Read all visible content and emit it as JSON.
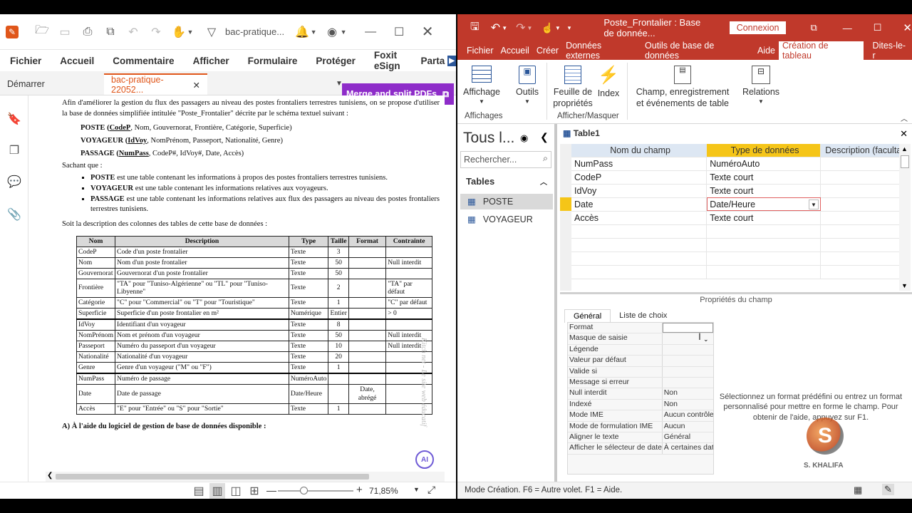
{
  "pdf": {
    "title": "bac-pratique...",
    "menu": [
      "Fichier",
      "Accueil",
      "Commentaire",
      "Afficher",
      "Formulaire",
      "Protéger",
      "Foxit eSign",
      "Parta"
    ],
    "tabs": {
      "start": "Démarrer",
      "doc": "bac-pratique-22052..."
    },
    "merge_label": "Merge and split PDFs",
    "watermark": "Kitch net - Le site web éducatif",
    "zoom": "71,85%",
    "doc": {
      "intro": "Afin d'améliorer la gestion du flux des passagers au niveau des postes frontaliers terrestres tunisiens, on se propose d'utiliser la base de données simplifiée intitulée \"Poste_Frontalier\" décrite par le schéma textuel suivant :",
      "schema": [
        {
          "name": "POSTE",
          "key": "CodeP",
          "rest": ", Nom, Gouvernorat, Frontière, Catégorie, Superficie)"
        },
        {
          "name": "VOYAGEUR",
          "key": "IdVoy",
          "rest": ", NomPrénom, Passeport, Nationalité, Genre)"
        },
        {
          "name": "PASSAGE",
          "key": "NumPass",
          "rest": ", CodeP#, IdVoy#, Date, Accès)"
        }
      ],
      "sachant": "Sachant que :",
      "bullets": [
        {
          "b": "POSTE",
          "t": " est une table contenant les informations à propos des postes frontaliers terrestres tunisiens."
        },
        {
          "b": "VOYAGEUR",
          "t": " est une table contenant les informations relatives aux voyageurs."
        },
        {
          "b": "PASSAGE",
          "t": " est une table contenant les informations relatives aux flux des passagers au niveau des postes frontaliers terrestres tunisiens."
        }
      ],
      "soit": "Soit la description des colonnes des tables de cette base de données :",
      "headers": [
        "Nom",
        "Description",
        "Type",
        "Taille",
        "Format",
        "Contrainte"
      ],
      "rows": [
        [
          "CodeP",
          "Code d'un poste frontalier",
          "Texte",
          "3",
          "",
          ""
        ],
        [
          "Nom",
          "Nom d'un poste frontalier",
          "Texte",
          "50",
          "",
          "Null interdit"
        ],
        [
          "Gouvernorat",
          "Gouvernorat d'un poste frontalier",
          "Texte",
          "50",
          "",
          ""
        ],
        [
          "Frontière",
          "\"TA\" pour \"Tuniso-Algérienne\" ou \"TL\" pour \"Tuniso-Libyenne\"",
          "Texte",
          "2",
          "",
          "\"TA\" par défaut"
        ],
        [
          "Catégorie",
          "\"C\" pour \"Commercial\" ou \"T\" pour \"Touristique\"",
          "Texte",
          "1",
          "",
          "\"C\" par défaut"
        ],
        [
          "Superficie",
          "Superficie d'un poste frontalier en m²",
          "Numérique",
          "Entier",
          "",
          "> 0"
        ],
        [
          "IdVoy",
          "Identifiant d'un voyageur",
          "Texte",
          "8",
          "",
          ""
        ],
        [
          "NomPrénom",
          "Nom et prénom d'un voyageur",
          "Texte",
          "50",
          "",
          "Null interdit"
        ],
        [
          "Passeport",
          "Numéro du passeport d'un voyageur",
          "Texte",
          "10",
          "",
          "Null interdit"
        ],
        [
          "Nationalité",
          "Nationalité d'un voyageur",
          "Texte",
          "20",
          "",
          ""
        ],
        [
          "Genre",
          "Genre d'un voyageur (\"M\" ou \"F\")",
          "Texte",
          "1",
          "",
          ""
        ],
        [
          "NumPass",
          "Numéro de passage",
          "NuméroAuto",
          "",
          "",
          ""
        ],
        [
          "Date",
          "Date de passage",
          "Date/Heure",
          "",
          "Date, abrégé",
          ""
        ],
        [
          "Accès",
          "\"E\" pour \"Entrée\" ou \"S\" pour \"Sortie\"",
          "Texte",
          "1",
          "",
          ""
        ]
      ],
      "question": "A) À l'aide du logiciel de gestion de base de données disponible :"
    }
  },
  "access": {
    "title": "Poste_Frontalier : Base de donnée...",
    "connexion": "Connexion",
    "tabs": [
      "Fichier",
      "Accueil",
      "Créer",
      "Données externes",
      "Outils de base de données",
      "Aide",
      "Création de tableau",
      "Dites-le-r"
    ],
    "ribbon": {
      "affichage": "Affichage",
      "outils": "Outils",
      "feuille": "Feuille de propriétés",
      "index": "Index",
      "champ": "Champ, enregistrement et événements de table",
      "relations": "Relations",
      "grp_affichages": "Affichages",
      "grp_afficher": "Afficher/Masquer"
    },
    "nav": {
      "title": "Tous l...",
      "search": "Rechercher...",
      "section": "Tables",
      "items": [
        "POSTE",
        "VOYAGEUR"
      ]
    },
    "table_tab": "Table1",
    "grid_headers": [
      "Nom du champ",
      "Type de données",
      "Description (facultat"
    ],
    "fields": [
      {
        "name": "NumPass",
        "type": "NuméroAuto"
      },
      {
        "name": "CodeP",
        "type": "Texte court"
      },
      {
        "name": "IdVoy",
        "type": "Texte court"
      },
      {
        "name": "Date",
        "type": "Date/Heure"
      },
      {
        "name": "Accès",
        "type": "Texte court"
      }
    ],
    "props_title": "Propriétés du champ",
    "props_tabs": [
      "Général",
      "Liste de choix"
    ],
    "props": [
      [
        "Format",
        ""
      ],
      [
        "Masque de saisie",
        ""
      ],
      [
        "Légende",
        ""
      ],
      [
        "Valeur par défaut",
        ""
      ],
      [
        "Valide si",
        ""
      ],
      [
        "Message si erreur",
        ""
      ],
      [
        "Null interdit",
        "Non"
      ],
      [
        "Indexé",
        "Non"
      ],
      [
        "Mode IME",
        "Aucun contrôle"
      ],
      [
        "Mode de formulation IME",
        "Aucun"
      ],
      [
        "Aligner le texte",
        "Général"
      ],
      [
        "Afficher le sélecteur de dates",
        "À certaines dates"
      ]
    ],
    "help": "Sélectionnez un format prédéfini ou entrez un format personnalisé pour mettre en forme le champ. Pour obtenir de l'aide, appuyez sur F1.",
    "logo_text": "S. KHALIFA",
    "status": "Mode Création. F6 = Autre volet. F1 = Aide."
  }
}
